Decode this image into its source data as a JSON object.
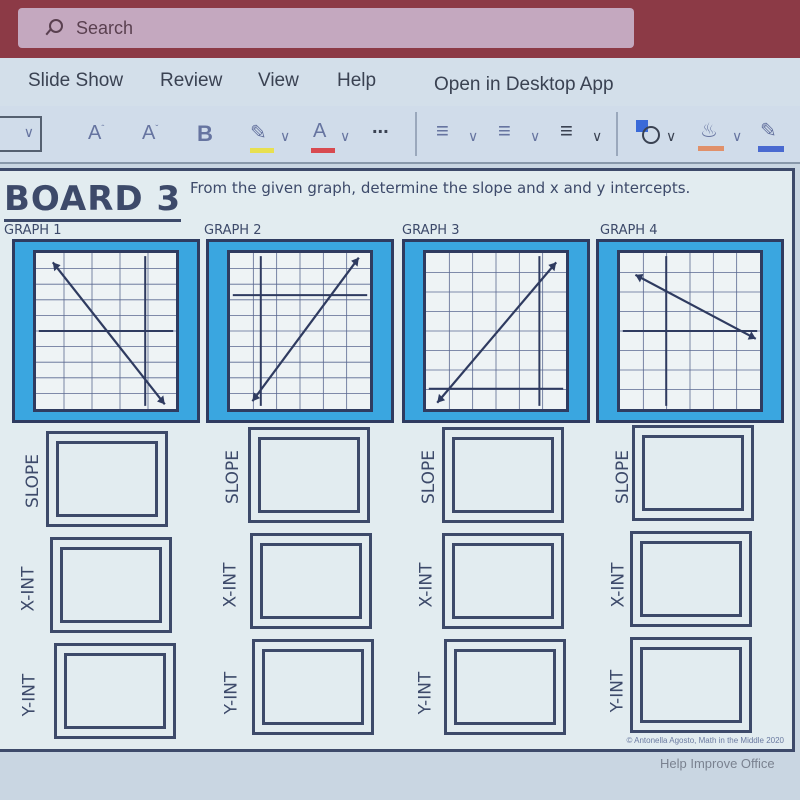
{
  "search": {
    "placeholder": "Search"
  },
  "menu": {
    "items": [
      "Slide Show",
      "Review",
      "View",
      "Help",
      "Open in Desktop App"
    ]
  },
  "toolbar": {
    "increase_font": "A",
    "decrease_font": "A",
    "bold": "B",
    "more": "...",
    "highlight_color": "#e8e050",
    "font_color": "#d84a50",
    "fill_color": "#e0906a",
    "outline_color": "#4a6ad0"
  },
  "worksheet": {
    "title": "BOARD 3",
    "instructions": "From the given graph, determine the slope and x and y intercepts.",
    "graphs": [
      {
        "label": "GRAPH 1"
      },
      {
        "label": "GRAPH 2"
      },
      {
        "label": "GRAPH 3"
      },
      {
        "label": "GRAPH 4"
      }
    ],
    "answer_labels": {
      "slope": "SLOPE",
      "x_int": "X-INT",
      "y_int": "Y-INT"
    },
    "copyright": "© Antonella Agosto, Math in the Middle 2020"
  },
  "footer": {
    "help": "Help Improve Office"
  },
  "colors": {
    "title_bar": "#8c3a46",
    "graph_frame": "#3aa6e0",
    "ink": "#3d4a6a"
  }
}
